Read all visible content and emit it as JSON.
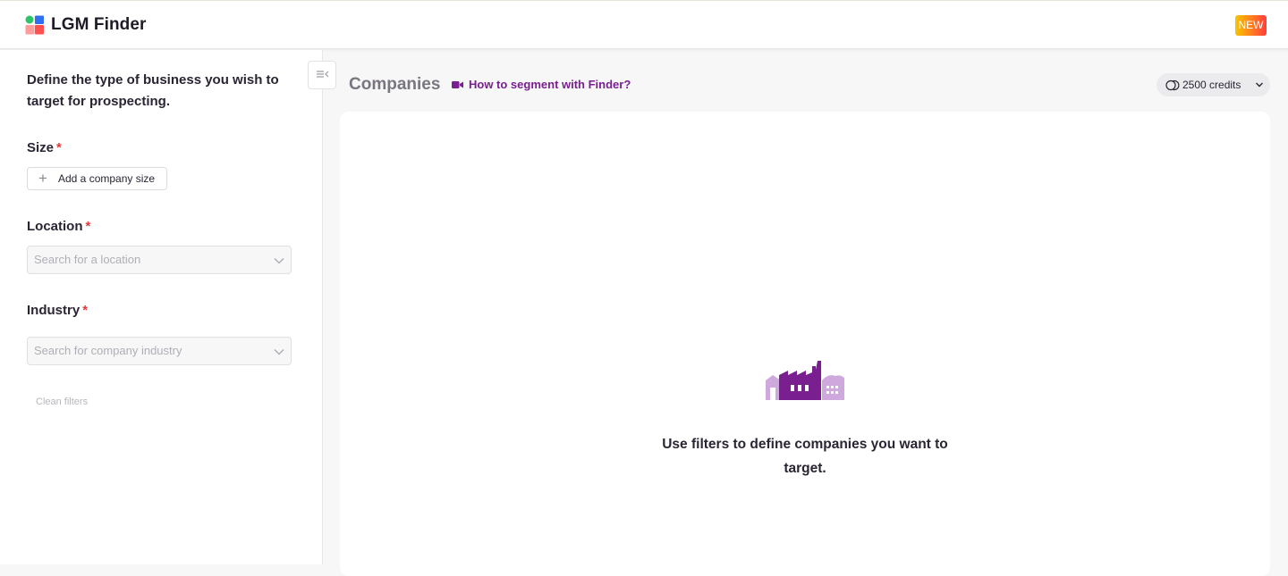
{
  "app": {
    "title": "LGM Finder",
    "badge": "NEW"
  },
  "sidebar": {
    "intro": "Define the type of business you wish to target for prospecting.",
    "size": {
      "label": "Size",
      "required": "*",
      "button_label": "Add a company size"
    },
    "location": {
      "label": "Location",
      "required": "*",
      "placeholder": "Search for a location"
    },
    "industry": {
      "label": "Industry",
      "required": "*",
      "placeholder": "Search for company industry"
    },
    "clean_filters": "Clean filters"
  },
  "main": {
    "title": "Companies",
    "howto_link": "How to segment with Finder?",
    "credits": "2500 credits",
    "empty_message": "Use filters to define companies you want to target."
  },
  "colors": {
    "accent_purple": "#7a1f8f",
    "required_red": "#e03a3a",
    "badge_gradient": [
      "#f7c600",
      "#ff7a21",
      "#ff3d3d"
    ]
  },
  "icons": {
    "logo": "lgm-logo-icon",
    "collapse": "collapse-sidebar-icon",
    "plus": "plus-icon",
    "chevron": "chevron-down-icon",
    "video": "video-camera-icon",
    "credits": "coins-icon",
    "illustration": "factory-illustration"
  }
}
